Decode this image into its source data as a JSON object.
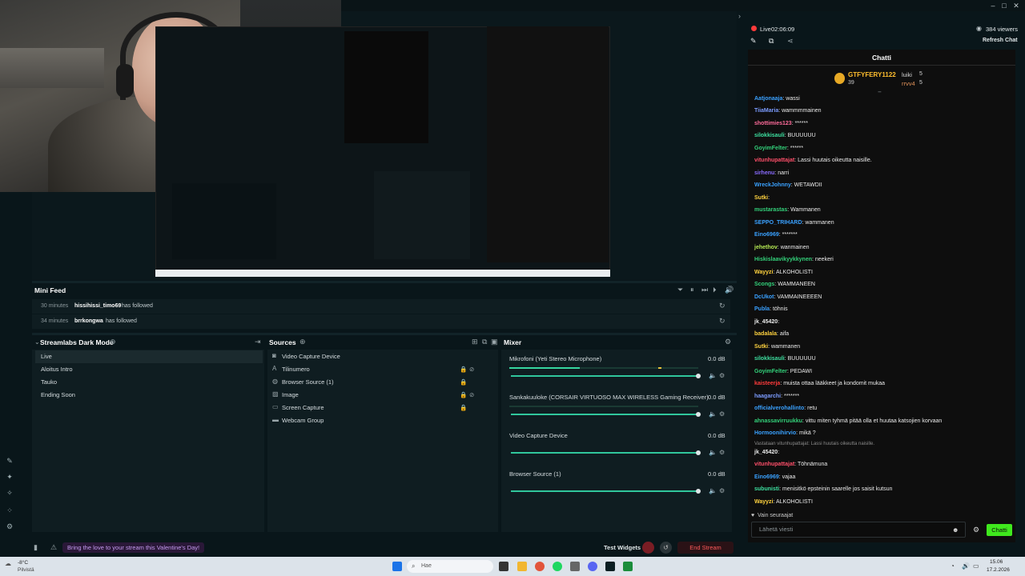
{
  "window": {
    "min": "–",
    "max": "□",
    "close": "✕"
  },
  "stream": {
    "live_label": "Live",
    "live_time": "02:06:09",
    "viewers": "384 viewers",
    "refresh_chat": "Refresh Chat"
  },
  "mini_feed": {
    "title": "Mini Feed",
    "items": [
      {
        "time": "30 minutes",
        "user": "hissihissi_timo69",
        "text": "has followed"
      },
      {
        "time": "34 minutes",
        "user": "brrkongwa",
        "text": "has followed"
      }
    ]
  },
  "scenes": {
    "title": "Streamlabs Dark Mode",
    "items": [
      "Live",
      "Aloitus Intro",
      "Tauko",
      "Ending Soon"
    ]
  },
  "sources": {
    "title": "Sources",
    "items": [
      "Video Capture Device",
      "Tilinumero",
      "Browser Source (1)",
      "Image",
      "Screen Capture",
      "Webcam Group"
    ]
  },
  "mixer": {
    "title": "Mixer",
    "items": [
      {
        "name": "Mikrofoni (Yeti Stereo Microphone)",
        "db": "0.0 dB",
        "level": 0.3
      },
      {
        "name": "Sankakuuloke (CORSAIR VIRTUOSO MAX WIRELESS Gaming Receiver)",
        "db": "0.0 dB",
        "level": 0.0
      },
      {
        "name": "Video Capture Device",
        "db": "0.0 dB",
        "level": 0.0
      },
      {
        "name": "Browser Source (1)",
        "db": "0.0 dB",
        "level": 0.0
      }
    ]
  },
  "status_bar": {
    "promo": "Bring the love to your stream this Valentine's Day!",
    "test_widgets": "Test Widgets",
    "end_stream": "End Stream"
  },
  "chat": {
    "title": "Chatti",
    "top": {
      "rank1_user": "GTFYFERY1122",
      "rank1_count": "39",
      "rank2_user": "luiki",
      "rank2_count": "5",
      "rank3_user": "rrvv4",
      "rank3_count": "5"
    },
    "messages": [
      {
        "user": "Aatjonaaja",
        "text": "wassi",
        "color": "#3aa1ff"
      },
      {
        "user": "TiiaMaria",
        "text": "wammmmainen",
        "color": "#7c9cff"
      },
      {
        "user": "shottimies123",
        "text": "******",
        "color": "#ff6b9a"
      },
      {
        "user": "silokkisauli",
        "text": "BUUUUUU",
        "color": "#3de0a0"
      },
      {
        "user": "GoyimFelter",
        "text": "******",
        "color": "#33d17a"
      },
      {
        "user": "vitunhupattajat",
        "text": "Lassi huutais oikeutta naisille.",
        "color": "#ff4f6a"
      },
      {
        "user": "sirhenu",
        "text": "narri",
        "color": "#8a6bff"
      },
      {
        "user": "WreckJohnny",
        "text": "WETAWDII",
        "color": "#3aa1ff"
      },
      {
        "user": "Sutki",
        "text": "",
        "color": "#ffd23f"
      },
      {
        "user": "mustarastas",
        "text": "Wammanen",
        "color": "#33d17a"
      },
      {
        "user": "SEPPO_TRIHARD",
        "text": "wammanen",
        "color": "#3aa1ff"
      },
      {
        "user": "Eino6969",
        "text": "*******",
        "color": "#3aa1ff"
      },
      {
        "user": "jehethov",
        "text": "wanmainen",
        "color": "#b5e853"
      },
      {
        "user": "Hiskislaavikyykkynen",
        "text": "neekeri",
        "color": "#33d17a"
      },
      {
        "user": "Wayyzi",
        "text": "ALKOHOLISTI",
        "color": "#ffd23f"
      },
      {
        "user": "Scongs",
        "text": "WAMMANEEN",
        "color": "#33d17a"
      },
      {
        "user": "DcUkot",
        "text": "VAMMAINEEEEN",
        "color": "#3aa1ff"
      },
      {
        "user": "Publa",
        "text": "töhnis",
        "color": "#3aa1ff"
      },
      {
        "user": "jk_45420",
        "text": "",
        "color": "#eaeaea"
      },
      {
        "user": "badalala",
        "text": "aifa",
        "color": "#ffd23f"
      },
      {
        "user": "Sutki",
        "text": "wammanen",
        "color": "#ffd23f"
      },
      {
        "user": "silokkisauli",
        "text": "BUUUUUU",
        "color": "#3de0a0"
      },
      {
        "user": "GoyimFelter",
        "text": "PEDAWI",
        "color": "#33d17a"
      },
      {
        "user": "kaisteerja",
        "text": "muista ottaa lääkkeet ja kondomit mukaa",
        "color": "#ff3b3b"
      },
      {
        "user": "haagarchi",
        "text": "*******",
        "color": "#7c9cff"
      },
      {
        "user": "officialverohallinto",
        "text": "retu",
        "color": "#3aa1ff"
      },
      {
        "user": "ahnassavirruukku",
        "text": "vittu miten tyhmä pitää olla et huutaa katsojien korvaan",
        "color": "#33d17a"
      },
      {
        "user": "Hormoonihirvio",
        "text": "mikä ?",
        "color": "#3aa1ff"
      },
      {
        "user": "jk_45420",
        "text": "",
        "color": "#eaeaea"
      },
      {
        "user": "vitunhupattajat",
        "text": "Töhnämuna",
        "color": "#ff4f6a"
      },
      {
        "user": "Eino6969",
        "text": "vajaa",
        "color": "#3aa1ff"
      },
      {
        "user": "subunisti",
        "text": "menisitkö epsteinin saarelle jos saisit kutsun",
        "color": "#3de0a0"
      },
      {
        "user": "Wayyzi",
        "text": "ALKOHOLISTI",
        "color": "#ffd23f"
      }
    ],
    "reply_note": "Vastataan vitunhupattajat: Lassi huutais oikeutta naisille.",
    "followers_only": "Vain seuraajat",
    "input_placeholder": "Lähetä viesti",
    "send_button": "Chatti"
  },
  "taskbar": {
    "weather": "-8°C",
    "weather_desc": "Pilvistä",
    "search": "Hae",
    "time": "15.06",
    "date": "17.2.2026"
  }
}
